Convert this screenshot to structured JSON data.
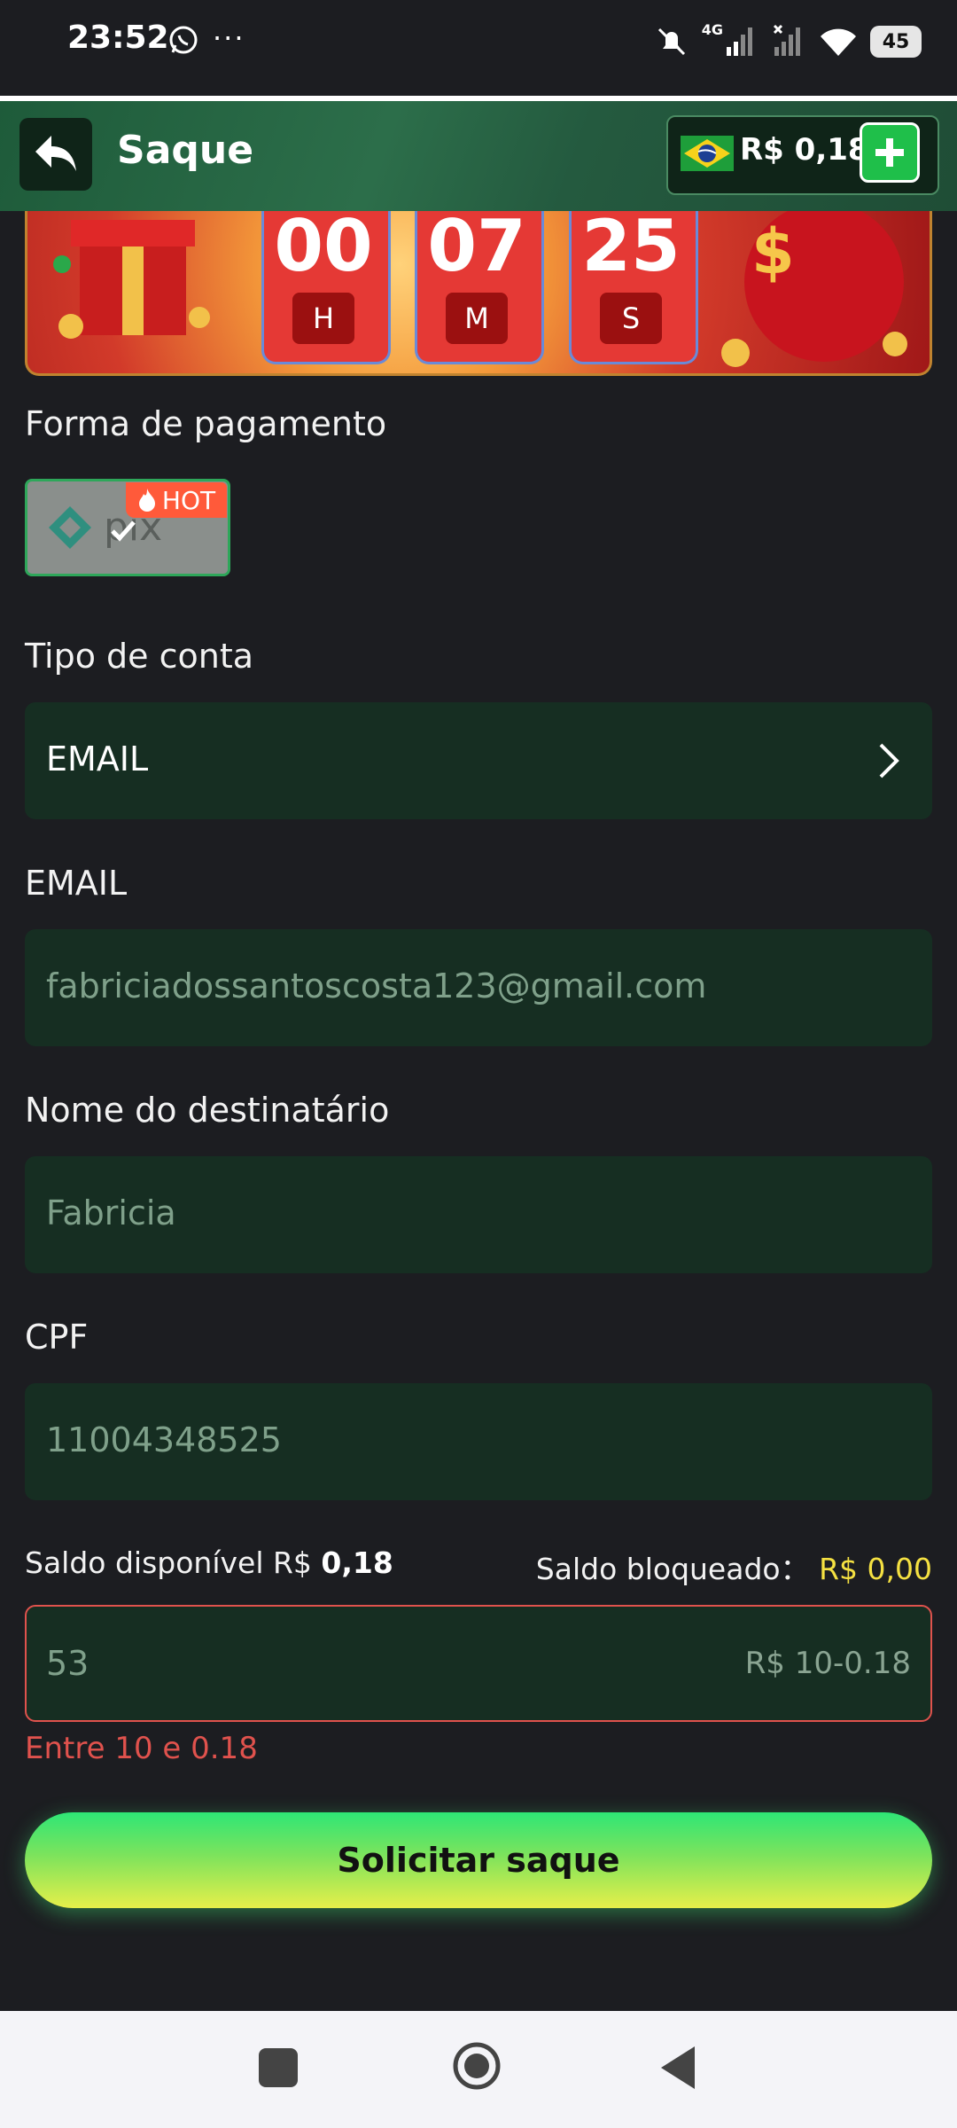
{
  "status_bar": {
    "time": "23:52",
    "dots": "···",
    "network": "4G",
    "battery": "45"
  },
  "header": {
    "title": "Saque",
    "balance": "R$ 0,18"
  },
  "countdown": {
    "hours": "00",
    "hours_label": "H",
    "minutes": "07",
    "minutes_label": "M",
    "seconds": "25",
    "seconds_label": "S"
  },
  "payment": {
    "label": "Forma de pagamento",
    "method_badge": "HOT"
  },
  "account_type": {
    "label": "Tipo de conta",
    "value": "EMAIL"
  },
  "email": {
    "label": "EMAIL",
    "value": "fabriciadossantoscosta123@gmail.com"
  },
  "recipient": {
    "label": "Nome do destinatário",
    "value": "Fabricia"
  },
  "cpf": {
    "label": "CPF",
    "value": "11004348525"
  },
  "saldo": {
    "available_label": "Saldo disponível R$",
    "available_value": "0,18",
    "blocked_label": "Saldo bloqueado：",
    "blocked_value": "R$ 0,00"
  },
  "amount": {
    "value": "53",
    "hint": "R$ 10-0.18",
    "error": "Entre 10 e 0.18"
  },
  "submit_label": "Solicitar saque",
  "colors": {
    "background": "#1c1d21",
    "field": "#162e22",
    "accent_green": "#1fbf4a",
    "error": "#e0524d",
    "yellow": "#f5e142"
  }
}
